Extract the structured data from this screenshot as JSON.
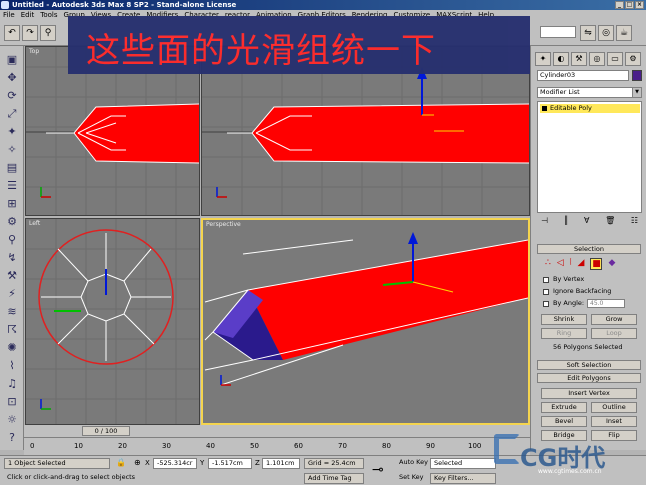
{
  "window": {
    "title": "Untitled - Autodesk 3ds Max 8 SP2 - Stand-alone License",
    "buttons": [
      "_",
      "□",
      "×"
    ]
  },
  "menubar": {
    "items": [
      "File",
      "Edit",
      "Tools",
      "Group",
      "Views",
      "Create",
      "Modifiers",
      "Character",
      "reactor",
      "Animation",
      "Graph Editors",
      "Rendering",
      "Customize",
      "MAXScript",
      "Help"
    ]
  },
  "overlay": {
    "text": "这些面的光滑组统一下"
  },
  "viewports": {
    "top": {
      "label": "Top"
    },
    "front": {
      "label": ""
    },
    "left": {
      "label": "Left"
    },
    "perspective": {
      "label": "Perspective"
    }
  },
  "command_panel": {
    "object_name": "Cylinder03",
    "object_color": "#4a1f8a",
    "modifier_list_label": "Modifier List",
    "stack_item": "Editable Poly",
    "selection": {
      "title": "Selection",
      "by_vertex": "By Vertex",
      "ignore_backfacing": "Ignore Backfacing",
      "by_angle": "By Angle:",
      "angle_value": "45.0",
      "shrink": "Shrink",
      "grow": "Grow",
      "ring": "Ring",
      "loop": "Loop",
      "status": "56 Polygons Selected"
    },
    "soft_selection_title": "Soft Selection",
    "edit_polygons": {
      "title": "Edit Polygons",
      "insert_vertex": "Insert Vertex",
      "extrude": "Extrude",
      "outline": "Outline",
      "bevel": "Bevel",
      "inset": "Inset",
      "bridge": "Bridge",
      "flip": "Flip"
    }
  },
  "timeline": {
    "slider": "0 / 100",
    "ticks": [
      "0",
      "10",
      "20",
      "30",
      "40",
      "50",
      "60",
      "70",
      "80",
      "90",
      "100"
    ]
  },
  "statusbar": {
    "selection": "1 Object Selected",
    "prompt": "Click or click-and-drag to select objects",
    "x_label": "X",
    "x_value": "-525.314cr",
    "y_label": "Y",
    "y_value": "-1.517cm",
    "z_label": "Z",
    "z_value": "1.101cm",
    "grid": "Grid = 25.4cm",
    "add_time_tag": "Add Time Tag",
    "auto_key": "Auto Key",
    "set_key": "Set Key",
    "selected": "Selected",
    "key_filters": "Key Filters..."
  },
  "watermark": {
    "brand": "CG时代",
    "url": "www.cgtimes.com.cn"
  }
}
